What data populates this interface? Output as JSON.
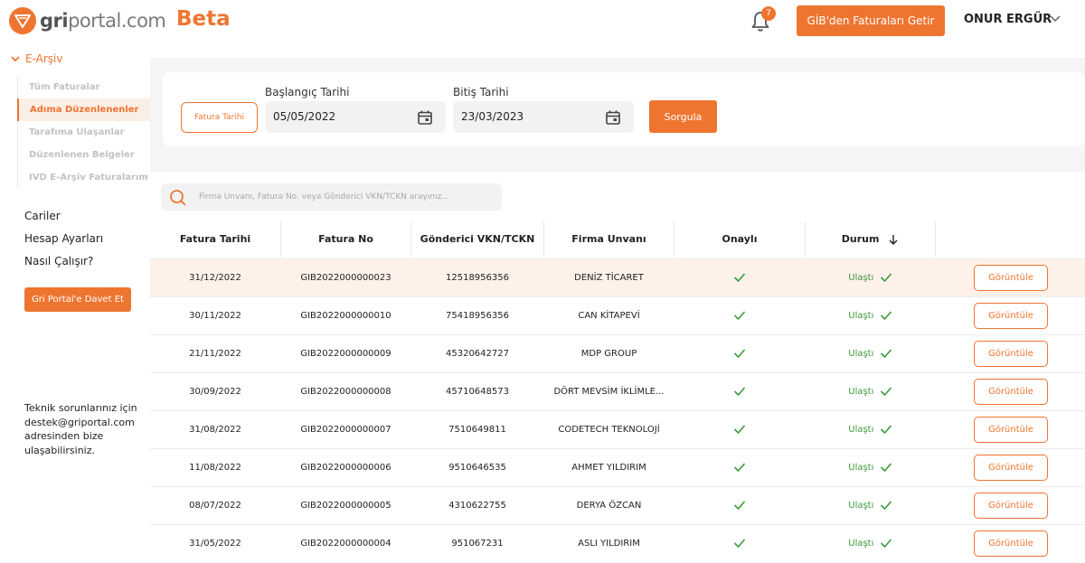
{
  "header": {
    "logo_bold": "gri",
    "logo_rest": "portal.com",
    "beta": "Beta",
    "notification_count": "7",
    "gib_button": "GİB'den Faturaları Getir",
    "user_name": "ONUR ERGÜR"
  },
  "sidebar": {
    "section": "E-Arşiv",
    "sub_items": [
      "Tüm Faturalar",
      "Adıma Düzenlenenler",
      "Tarafıma Ulaşanlar",
      "Düzenlenen Belgeler",
      "IVD E-Arşiv Faturalarım"
    ],
    "main_items": [
      "Cariler",
      "Hesap Ayarları",
      "Nasıl Çalışır?"
    ],
    "invite_button": "Gri Portal'e Davet Et",
    "support_text": "Teknik sorunlarınız için destek@griportal.com adresinden bize ulaşabilirsiniz."
  },
  "filter": {
    "date_button": "Fatura Tarihi",
    "start_label": "Başlangıç Tarihi",
    "start_value": "05/05/2022",
    "end_label": "Bitiş Tarihi",
    "end_value": "23/03/2023",
    "query_button": "Sorgula"
  },
  "search": {
    "placeholder": "Firma Unvanı, Fatura No. veya Gönderici VKN/TCKN arayınız..."
  },
  "table": {
    "headers": [
      "Fatura Tarihi",
      "Fatura No",
      "Gönderici VKN/TCKN",
      "Firma Unvanı",
      "Onaylı",
      "Durum"
    ],
    "status_label": "Ulaştı",
    "view_label": "Görüntüle",
    "rows": [
      {
        "date": "31/12/2022",
        "no": "GIB2022000000023",
        "vkn": "12518956356",
        "firm": "DENİZ TİCARET"
      },
      {
        "date": "30/11/2022",
        "no": "GIB2022000000010",
        "vkn": "75418956356",
        "firm": "CAN KİTAPEVİ"
      },
      {
        "date": "21/11/2022",
        "no": "GIB2022000000009",
        "vkn": "45320642727",
        "firm": "MDP GROUP"
      },
      {
        "date": "30/09/2022",
        "no": "GIB2022000000008",
        "vkn": "45710648573",
        "firm": "DÖRT MEVSİM İKLİMLE..."
      },
      {
        "date": "31/08/2022",
        "no": "GIB2022000000007",
        "vkn": "7510649811",
        "firm": "CODETECH TEKNOLOJİ"
      },
      {
        "date": "11/08/2022",
        "no": "GIB2022000000006",
        "vkn": "9510646535",
        "firm": "AHMET YILDIRIM"
      },
      {
        "date": "08/07/2022",
        "no": "GIB2022000000005",
        "vkn": "4310622755",
        "firm": "DERYA ÖZCAN"
      },
      {
        "date": "31/05/2022",
        "no": "GIB2022000000004",
        "vkn": "951067231",
        "firm": "ASLI YILDIRIM"
      }
    ]
  },
  "colors": {
    "accent": "#ee7530",
    "success": "#3a9a3a",
    "highlight_row": "#fdf1ea"
  }
}
